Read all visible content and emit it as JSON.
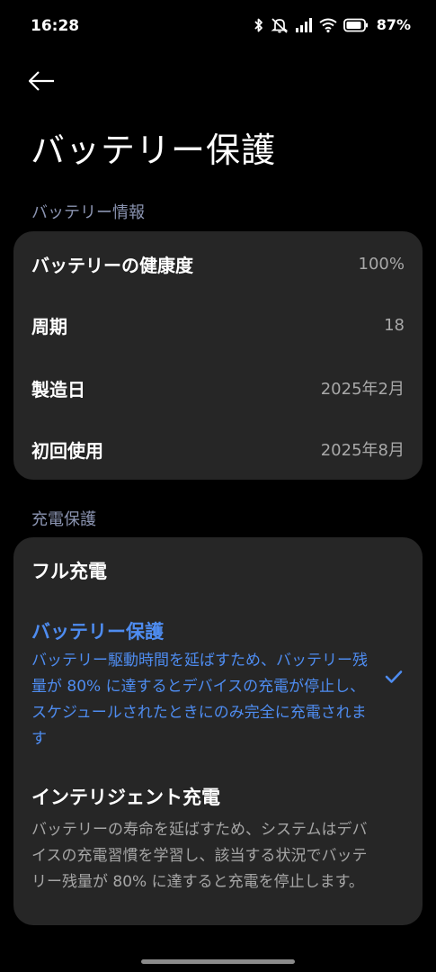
{
  "status_bar": {
    "time": "16:28",
    "battery_percent": "87%",
    "icons": [
      "bluetooth-icon",
      "mute-icon",
      "signal-icon",
      "wifi-icon",
      "battery-icon"
    ]
  },
  "header": {
    "back_icon": "arrow-left-icon",
    "title": "バッテリー保護"
  },
  "battery_info": {
    "section_title": "バッテリー情報",
    "rows": [
      {
        "label": "バッテリーの健康度",
        "value": "100%"
      },
      {
        "label": "周期",
        "value": "18"
      },
      {
        "label": "製造日",
        "value": "2025年2月"
      },
      {
        "label": "初回使用",
        "value": "2025年8月"
      }
    ]
  },
  "charge_protection": {
    "section_title": "充電保護",
    "options": [
      {
        "title": "フル充電",
        "description": "",
        "selected": false
      },
      {
        "title": "バッテリー保護",
        "description": "バッテリー駆動時間を延ばすため、バッテリー残量が 80% に達するとデバイスの充電が停止し、スケジュールされたときにのみ完全に充電されます",
        "selected": true
      },
      {
        "title": "インテリジェント充電",
        "description": "バッテリーの寿命を延ばすため、システムはデバイスの充電習慣を学習し、該当する状況でバッテリー残量が 80% に達すると充電を停止します。",
        "selected": false
      }
    ],
    "check_icon": "checkmark-icon"
  },
  "colors": {
    "accent": "#4e8cf0",
    "card_bg": "#262626",
    "section_label": "#8a93b0"
  }
}
